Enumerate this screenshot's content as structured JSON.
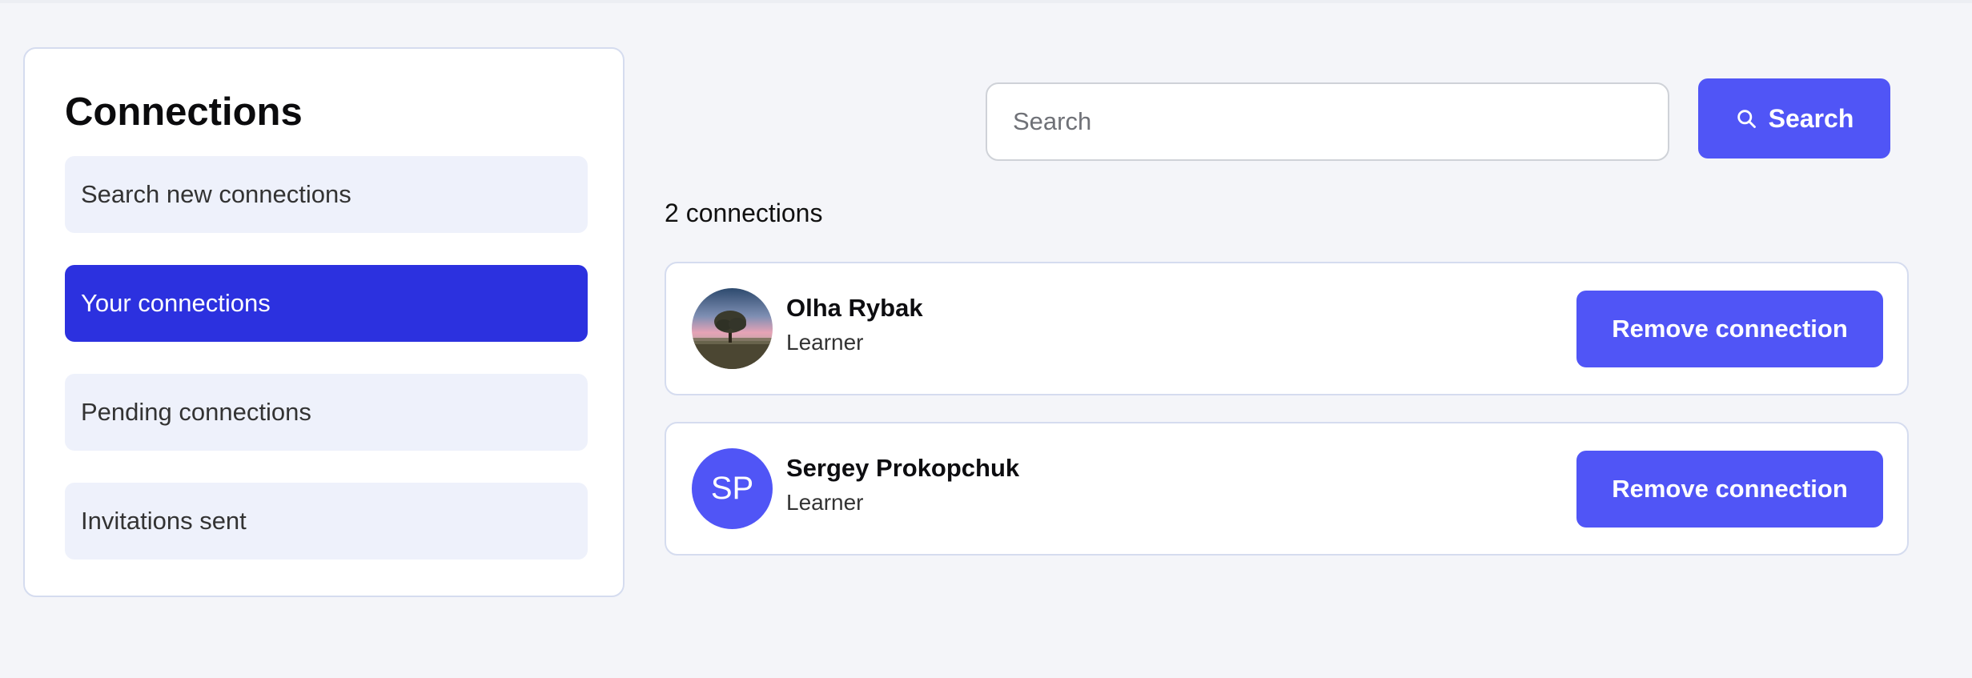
{
  "sidebar": {
    "title": "Connections",
    "items": [
      {
        "label": "Search new connections",
        "active": false
      },
      {
        "label": "Your connections",
        "active": true
      },
      {
        "label": "Pending connections",
        "active": false
      },
      {
        "label": "Invitations sent",
        "active": false
      }
    ]
  },
  "search": {
    "placeholder": "Search",
    "value": "",
    "button_label": "Search",
    "button_icon": "search-icon"
  },
  "connections": {
    "count_text": "2 connections",
    "items": [
      {
        "name": "Olha Rybak",
        "role": "Learner",
        "avatar": "photo",
        "action_label": "Remove connection"
      },
      {
        "name": "Sergey Prokopchuk",
        "role": "Learner",
        "avatar_initials": "SP",
        "action_label": "Remove connection"
      }
    ]
  },
  "colors": {
    "accent": "#5055f6",
    "active_nav": "#2c31df",
    "nav_bg": "#eef1fb",
    "page_bg": "#f4f5f9",
    "card_border": "#d5dcef"
  }
}
